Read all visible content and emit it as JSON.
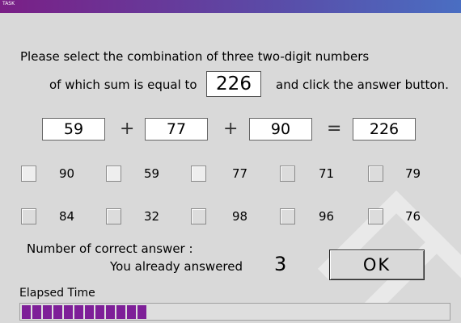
{
  "window": {
    "title": "TASK"
  },
  "instructions": {
    "line1": "Please select the combination of three two-digit numbers",
    "line2_before": "of which sum is equal to",
    "target": "226",
    "line2_after": "and click the answer button."
  },
  "equation": {
    "first": "59",
    "plus1": "+",
    "second": "77",
    "plus2": "+",
    "third": "90",
    "equals": "=",
    "result": "226"
  },
  "options": [
    {
      "value": "90"
    },
    {
      "value": "59"
    },
    {
      "value": "77"
    },
    {
      "value": "71"
    },
    {
      "value": "79"
    },
    {
      "value": "84"
    },
    {
      "value": "32"
    },
    {
      "value": "98"
    },
    {
      "value": "96"
    },
    {
      "value": "76"
    }
  ],
  "status": {
    "correct_label": "Number of correct answer :",
    "answered_label": "You already answered",
    "answered_count": "3"
  },
  "ok_button": "OK",
  "timer": {
    "label": "Elapsed Time",
    "progress": 0.3
  },
  "colors": {
    "titlebar": "#7a1f86",
    "progress_fill": "#7e1f98",
    "background": "#d9d9d9"
  }
}
